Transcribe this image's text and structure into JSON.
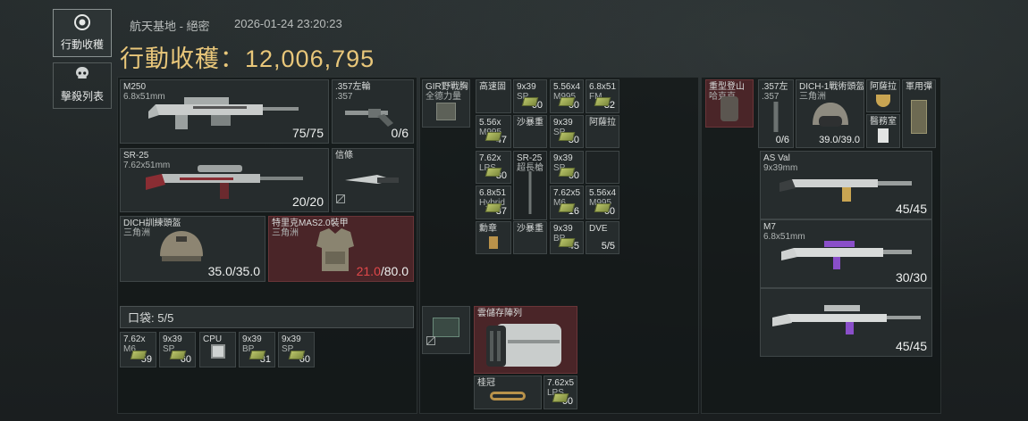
{
  "nav": [
    {
      "label": "行動收穫",
      "icon": "target-icon",
      "active": true
    },
    {
      "label": "擊殺列表",
      "icon": "skull-icon",
      "active": false
    }
  ],
  "header": {
    "location": "航天基地 - 絕密",
    "timestamp": "2026-01-24 23:20:23",
    "title_label": "行動收穫：",
    "title_value": "12,006,795"
  },
  "equipment": {
    "primary": {
      "name": "M250",
      "sub": "6.8x51mm",
      "count": "75/75"
    },
    "pistol": {
      "name": ".357左輪",
      "sub": ".357",
      "count": "0/6"
    },
    "secondary": {
      "name": "SR-25",
      "sub": "7.62x51mm",
      "count": "20/20"
    },
    "melee": {
      "name": "信條"
    },
    "helmet": {
      "name": "DICH訓練頭盔",
      "sub": "三角洲",
      "count": "35.0/35.0"
    },
    "armor": {
      "name": "特里克MAS2.0裝甲",
      "sub": "三角洲",
      "count_damaged": "21.0",
      "count_max": "/80.0"
    }
  },
  "pocket": {
    "label": "口袋: 5/5",
    "items": [
      {
        "l1": "7.62x",
        "l2": "M6",
        "c": "59"
      },
      {
        "l1": "9x39",
        "l2": "SP",
        "c": "60"
      },
      {
        "l1": "CPU",
        "l2": "",
        "c": ""
      },
      {
        "l1": "9x39",
        "l2": "BP",
        "c": "31"
      },
      {
        "l1": "9x39",
        "l2": "SP",
        "c": "60"
      }
    ]
  },
  "chest_rig": {
    "name": "GIR野戰胸",
    "sub": "全德力量",
    "items": [
      {
        "l1": "高速固",
        "l2": "",
        "c": ""
      },
      {
        "l1": "9x39",
        "l2": "SP",
        "c": "60"
      },
      {
        "l1": "5.56x4",
        "l2": "M995",
        "c": "60"
      },
      {
        "l1": "6.8x51",
        "l2": "FM",
        "c": "32"
      },
      {
        "l1": "5.56x",
        "l2": "M995",
        "c": "47"
      },
      {
        "l1": "沙暴重",
        "l2": "",
        "c": ""
      },
      {
        "l1": "9x39",
        "l2": "SP",
        "c": "30"
      },
      {
        "l1": "阿薩拉",
        "l2": "",
        "c": ""
      }
    ]
  },
  "backpack": {
    "items": [
      {
        "l1": "7.62x",
        "l2": "LPS",
        "c": "30"
      },
      {
        "l1": "SR-25",
        "l2": "超長槍",
        "c": ""
      },
      {
        "l1": "9x39",
        "l2": "SP",
        "c": "60"
      },
      {
        "l1": "6.8x51",
        "l2": "Hybrid",
        "c": "37"
      },
      {
        "l1": "7.62x5",
        "l2": "M6",
        "c": "16"
      },
      {
        "l1": "5.56x4",
        "l2": "M995",
        "c": "60"
      },
      {
        "l1": "勳章",
        "l2": "",
        "c": ""
      },
      {
        "l1": "沙暴重",
        "l2": "",
        "c": ""
      },
      {
        "l1": "9x39",
        "l2": "BP",
        "c": "45"
      },
      {
        "l1": "DVE",
        "l2": "",
        "c": "5/5"
      }
    ]
  },
  "safebox": {
    "name": "雲儲存陣列",
    "items": [
      {
        "l1": "桂冠",
        "l2": "",
        "c": ""
      },
      {
        "l1": "7.62x5",
        "l2": "LPS",
        "c": "60"
      }
    ]
  },
  "right_top": [
    {
      "l1": "重型登山",
      "l2": "哈克克",
      "c": ""
    },
    {
      "l1": ".357左",
      "l2": ".357",
      "c": "0/6"
    },
    {
      "l1": "DICH-1戰術頭盔",
      "l2": "三角洲",
      "c": "39.0/39.0"
    },
    {
      "l1": "阿薩拉",
      "l2": "",
      "c": ""
    },
    {
      "l1": "軍用彈",
      "l2": "",
      "c": ""
    }
  ],
  "right_small": {
    "l1": "醫務室",
    "c": ""
  },
  "right_guns": [
    {
      "name": "AS Val",
      "sub": "9x39mm",
      "count": "45/45"
    },
    {
      "name": "M7",
      "sub": "6.8x51mm",
      "count": "30/30"
    },
    {
      "name": "",
      "sub": "",
      "count": "45/45"
    }
  ],
  "colors": {
    "accent_gold": "#e9c77a",
    "damaged_red": "#e0484a",
    "red_slot": "#4a2528"
  }
}
